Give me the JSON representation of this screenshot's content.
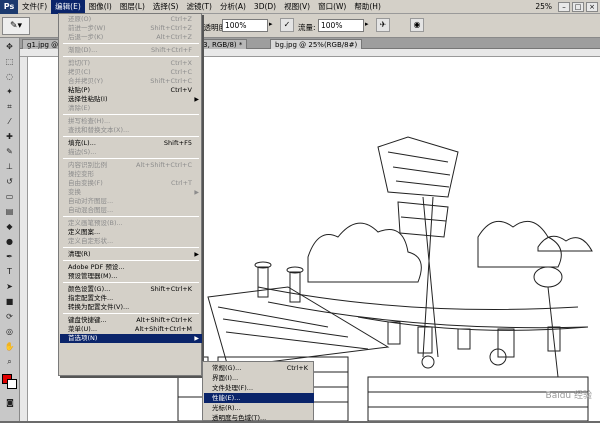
{
  "menubar": {
    "logo": "Ps",
    "items": [
      "文件(F)",
      "编辑(E)",
      "图像(I)",
      "图层(L)",
      "选择(S)",
      "滤镜(T)",
      "分析(A)",
      "3D(D)",
      "视图(V)",
      "窗口(W)",
      "帮助(H)"
    ],
    "zoom": "25%"
  },
  "options": {
    "opacity_label": "不透明度:",
    "opacity_value": "100%",
    "flow_label": "流量:",
    "flow_value": "100%"
  },
  "tabs": [
    {
      "label": "g1.jpg @ 25%..."
    },
    {
      "label": "... 层 3, RGB/8) *"
    },
    {
      "label": "bg.jpg @ 25%(RGB/8#)"
    }
  ],
  "edit_menu": [
    {
      "label": "还原(O)",
      "shortcut": "Ctrl+Z",
      "disabled": true
    },
    {
      "label": "前进一步(W)",
      "shortcut": "Shift+Ctrl+Z",
      "disabled": true
    },
    {
      "label": "后退一步(K)",
      "shortcut": "Alt+Ctrl+Z",
      "disabled": true
    },
    {
      "sep": true
    },
    {
      "label": "渐隐(D)...",
      "shortcut": "Shift+Ctrl+F",
      "disabled": true
    },
    {
      "sep": true
    },
    {
      "label": "剪切(T)",
      "shortcut": "Ctrl+X",
      "disabled": true
    },
    {
      "label": "拷贝(C)",
      "shortcut": "Ctrl+C",
      "disabled": true
    },
    {
      "label": "合并拷贝(Y)",
      "shortcut": "Shift+Ctrl+C",
      "disabled": true
    },
    {
      "label": "粘贴(P)",
      "shortcut": "Ctrl+V",
      "disabled": false
    },
    {
      "label": "选择性粘贴(I)",
      "shortcut": "",
      "disabled": false,
      "submenu": true
    },
    {
      "label": "清除(E)",
      "shortcut": "",
      "disabled": true
    },
    {
      "sep": true
    },
    {
      "label": "拼写检查(H)...",
      "shortcut": "",
      "disabled": true
    },
    {
      "label": "查找和替换文本(X)...",
      "shortcut": "",
      "disabled": true
    },
    {
      "sep": true
    },
    {
      "label": "填充(L)...",
      "shortcut": "Shift+F5",
      "disabled": false
    },
    {
      "label": "描边(S)...",
      "shortcut": "",
      "disabled": true
    },
    {
      "sep": true
    },
    {
      "label": "内容识别比例",
      "shortcut": "Alt+Shift+Ctrl+C",
      "disabled": true
    },
    {
      "label": "操控变形",
      "shortcut": "",
      "disabled": true
    },
    {
      "label": "自由变换(F)",
      "shortcut": "Ctrl+T",
      "disabled": true
    },
    {
      "label": "变换",
      "shortcut": "",
      "disabled": true,
      "submenu": true
    },
    {
      "label": "自动对齐图层...",
      "shortcut": "",
      "disabled": true
    },
    {
      "label": "自动混合图层...",
      "shortcut": "",
      "disabled": true
    },
    {
      "sep": true
    },
    {
      "label": "定义画笔预设(B)...",
      "shortcut": "",
      "disabled": true
    },
    {
      "label": "定义图案...",
      "shortcut": "",
      "disabled": false
    },
    {
      "label": "定义自定形状...",
      "shortcut": "",
      "disabled": true
    },
    {
      "sep": true
    },
    {
      "label": "清理(R)",
      "shortcut": "",
      "disabled": false,
      "submenu": true
    },
    {
      "sep": true
    },
    {
      "label": "Adobe PDF 预设...",
      "shortcut": "",
      "disabled": false
    },
    {
      "label": "预设管理器(M)...",
      "shortcut": "",
      "disabled": false
    },
    {
      "sep": true
    },
    {
      "label": "颜色设置(G)...",
      "shortcut": "Shift+Ctrl+K",
      "disabled": false
    },
    {
      "label": "指定配置文件...",
      "shortcut": "",
      "disabled": false
    },
    {
      "label": "转换为配置文件(V)...",
      "shortcut": "",
      "disabled": false
    },
    {
      "sep": true
    },
    {
      "label": "键盘快捷键...",
      "shortcut": "Alt+Shift+Ctrl+K",
      "disabled": false
    },
    {
      "label": "菜单(U)...",
      "shortcut": "Alt+Shift+Ctrl+M",
      "disabled": false
    },
    {
      "label": "首选项(N)",
      "shortcut": "",
      "disabled": false,
      "submenu": true,
      "selected": true
    }
  ],
  "prefs_submenu": [
    {
      "label": "常规(G)...",
      "shortcut": "Ctrl+K"
    },
    {
      "label": "界面(I)...",
      "shortcut": ""
    },
    {
      "label": "文件处理(F)...",
      "shortcut": ""
    },
    {
      "label": "性能(E)...",
      "shortcut": "",
      "selected": true
    },
    {
      "label": "光标(R)...",
      "shortcut": ""
    },
    {
      "label": "透明度与色域(T)...",
      "shortcut": ""
    }
  ],
  "watermark": "Baidu 经验"
}
